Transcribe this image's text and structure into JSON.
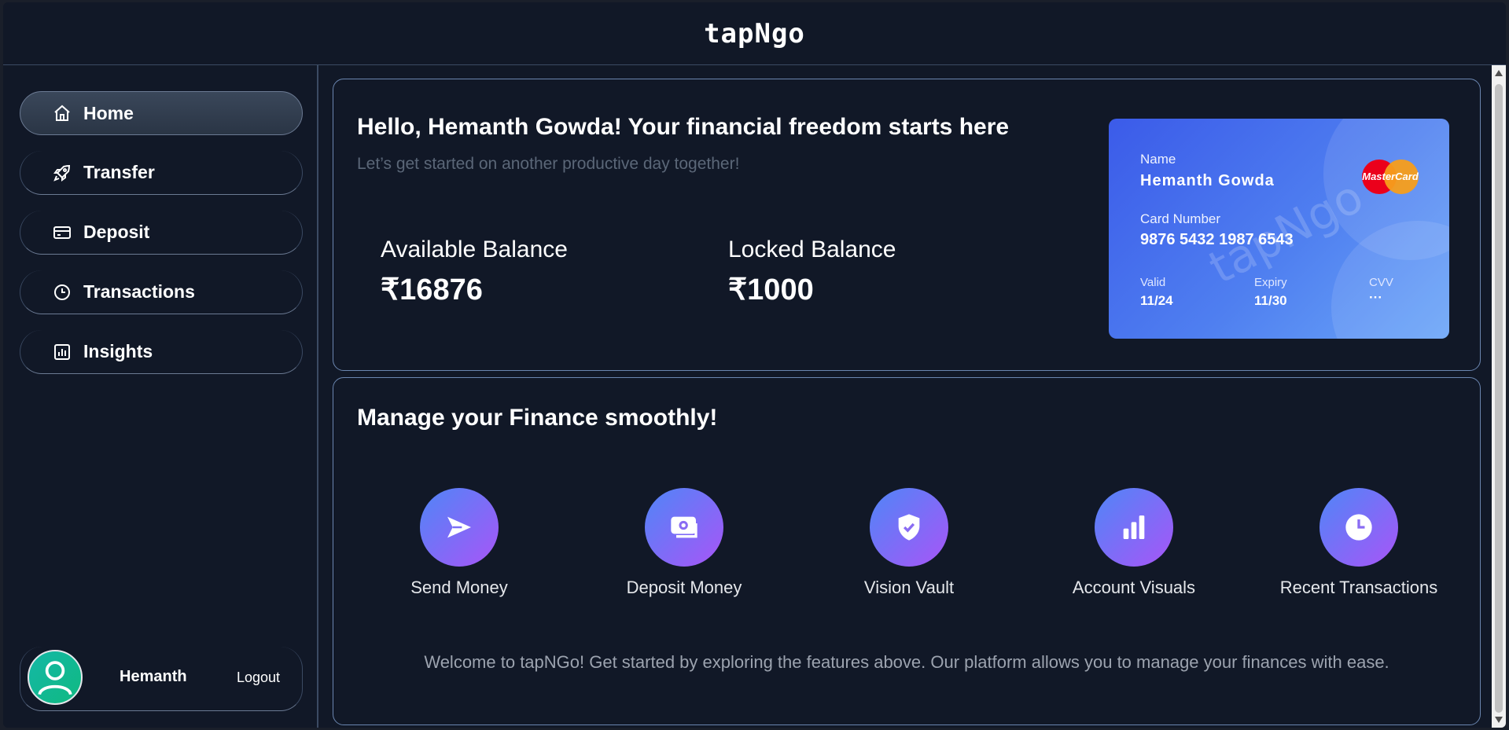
{
  "app": {
    "brand": "tapNgo"
  },
  "sidebar": {
    "items": [
      {
        "label": "Home",
        "icon": "home-icon"
      },
      {
        "label": "Transfer",
        "icon": "rocket-icon"
      },
      {
        "label": "Deposit",
        "icon": "card-icon"
      },
      {
        "label": "Transactions",
        "icon": "clock-icon"
      },
      {
        "label": "Insights",
        "icon": "chart-icon"
      }
    ],
    "active": "Home",
    "profile": {
      "name": "Hemanth",
      "logout": "Logout"
    }
  },
  "hero": {
    "greeting": "Hello, Hemanth Gowda! Your financial freedom starts here",
    "subtitle": "Let’s get started on another productive day together!",
    "available_label": "Available Balance",
    "available_value": "₹16876",
    "locked_label": "Locked Balance",
    "locked_value": "₹1000"
  },
  "card": {
    "name_label": "Name",
    "name_value": "Hemanth Gowda",
    "number_label": "Card Number",
    "number_value": "9876 5432 1987 6543",
    "watermark": "tapNgo",
    "brand": "MasterCard",
    "valid_label": "Valid",
    "valid_value": "11/24",
    "expiry_label": "Expiry",
    "expiry_value": "11/30",
    "cvv_label": "CVV",
    "cvv_value": "···"
  },
  "manage": {
    "title": "Manage your Finance smoothly!",
    "actions": [
      {
        "label": "Send Money",
        "icon": "send-icon"
      },
      {
        "label": "Deposit Money",
        "icon": "cash-icon"
      },
      {
        "label": "Vision Vault",
        "icon": "shield-icon"
      },
      {
        "label": "Account Visuals",
        "icon": "bar-chart-icon"
      },
      {
        "label": "Recent Transactions",
        "icon": "clock-icon"
      }
    ],
    "welcome": "Welcome to tapNGo! Get started by exploring the features above. Our platform allows you to manage your finances with ease."
  },
  "colors": {
    "background": "#111827",
    "panel_border": "#6b86b0",
    "accent_start": "#4f86f7",
    "accent_end": "#a855f7"
  }
}
